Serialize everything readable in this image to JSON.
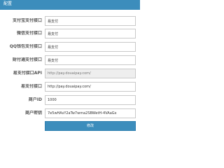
{
  "header": {
    "title": "配置"
  },
  "form": {
    "fields": [
      {
        "label": "支付宝支付接口",
        "value": "易支付",
        "readonly": false
      },
      {
        "label": "微信支付接口",
        "value": "易支付",
        "readonly": false
      },
      {
        "label": "QQ钱包支付接口",
        "value": "易支付",
        "readonly": false
      },
      {
        "label": "财付通支付接口",
        "value": "易支付",
        "readonly": false
      },
      {
        "label": "易支付接口API",
        "value": "http://pay.douaipay.com/",
        "readonly": true
      },
      {
        "label": "易支付接口",
        "value": "http://pay.douaipay.com/",
        "readonly": false
      },
      {
        "label": "商户ID",
        "value": "1000",
        "readonly": false
      },
      {
        "label": "商户密钥",
        "value": "7e5wHAsY2aTw7wma2SBWetH-4VAaGx",
        "readonly": false
      }
    ],
    "submit_label": "修改"
  },
  "colors": {
    "header_bg": "#3c8dbc",
    "button_bg": "#3c8dbc",
    "readonly_bg": "#eeeeee"
  }
}
